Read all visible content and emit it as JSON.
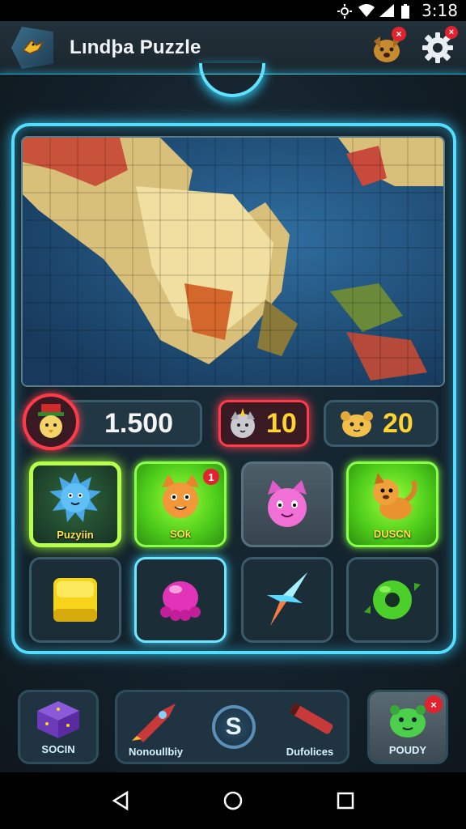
{
  "status": {
    "time": "3:18"
  },
  "app": {
    "title": "Lındþa Puzzle"
  },
  "header": {
    "pet_badge": "×",
    "settings_badge": "×"
  },
  "stats": {
    "coins": "1.500",
    "energy": "10",
    "pets": "20"
  },
  "grid": [
    {
      "label": "Puzyiin",
      "kind": "blue-fuzzball",
      "style": "selected"
    },
    {
      "label": "SOƙ",
      "kind": "orange-cat",
      "style": "green",
      "badge": "1"
    },
    {
      "label": "",
      "kind": "pink-cat",
      "style": "grey"
    },
    {
      "label": "DUSCN",
      "kind": "orange-dog",
      "style": "green"
    },
    {
      "label": "",
      "kind": "yellow-cube",
      "style": "plain"
    },
    {
      "label": "",
      "kind": "pink-jelly",
      "style": "cyan"
    },
    {
      "label": "",
      "kind": "star-shard",
      "style": "plain"
    },
    {
      "label": "",
      "kind": "green-donut",
      "style": "plain"
    }
  ],
  "toolbar": {
    "shop_label": "SOCIN",
    "left_label": "Nonoullbiy",
    "center_symbol": "S",
    "right_label": "Dufolices",
    "pouch_label": "POUDY",
    "pouch_badge": "×"
  },
  "colors": {
    "accent": "#55dcff",
    "energy": "#ff3a4a",
    "highlight": "#ffd430",
    "green": "#7cff3a"
  }
}
